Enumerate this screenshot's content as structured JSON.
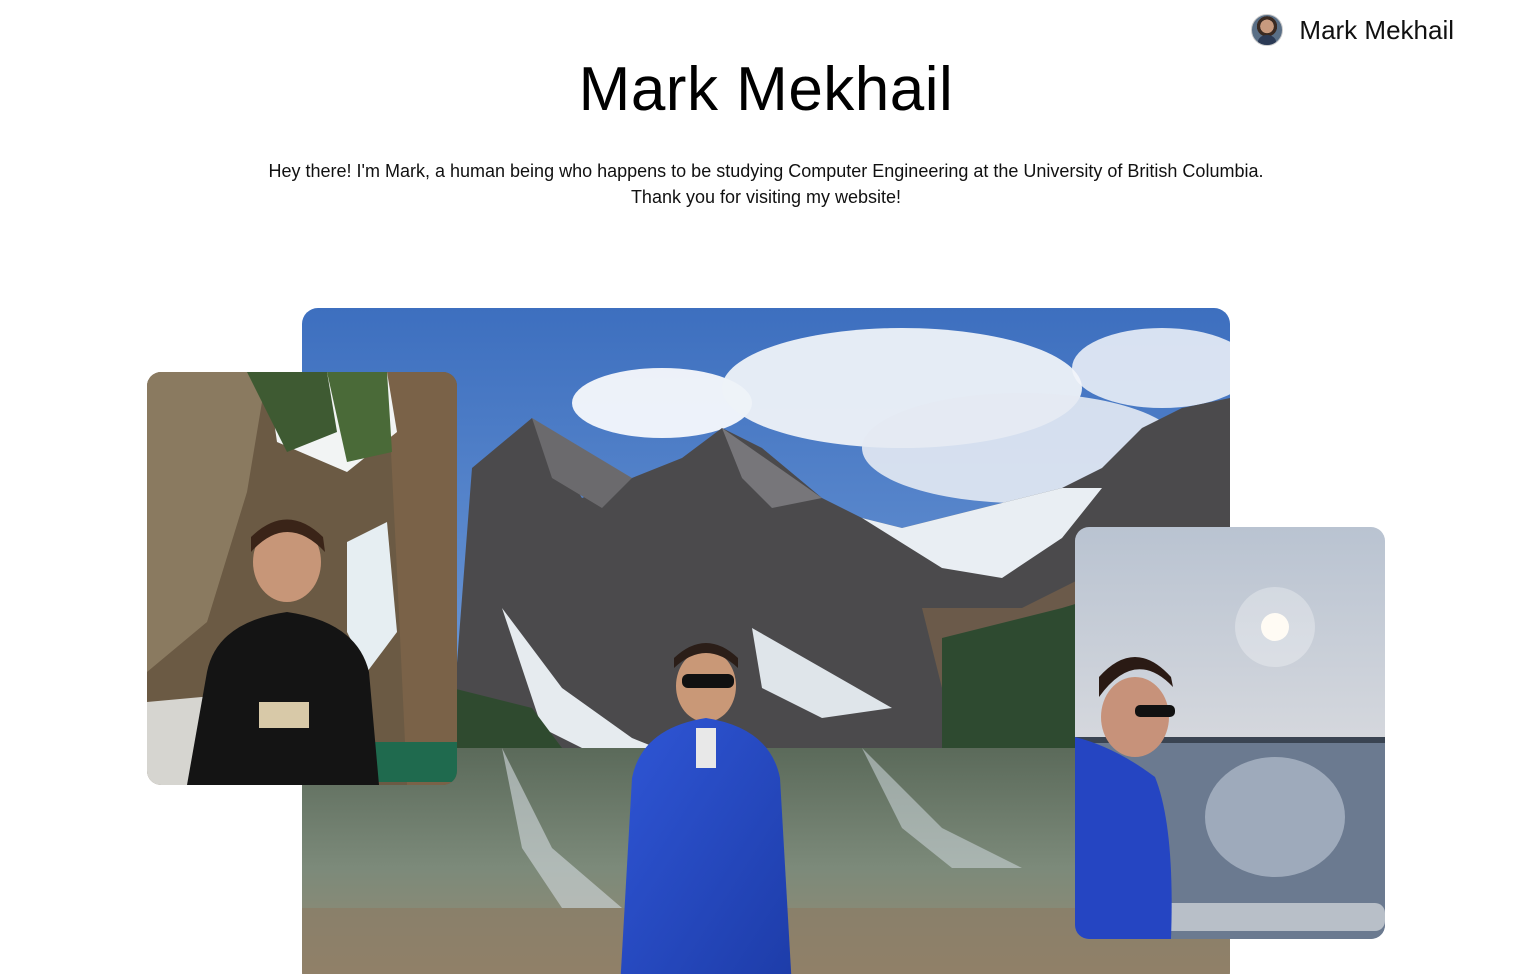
{
  "header": {
    "avatar_icon": "user-avatar",
    "name": "Mark Mekhail"
  },
  "hero": {
    "title": "Mark Mekhail",
    "intro_line1": "Hey there! I'm Mark, a human being who happens to be studying Computer Engineering at the University of British Columbia.",
    "intro_line2": "Thank you for visiting my website!"
  },
  "gallery": {
    "photos": [
      {
        "id": "waterfall",
        "description": "canyon-waterfall-photo"
      },
      {
        "id": "lake",
        "description": "mountain-lake-photo"
      },
      {
        "id": "boat",
        "description": "boat-lake-sunset-photo"
      }
    ]
  }
}
